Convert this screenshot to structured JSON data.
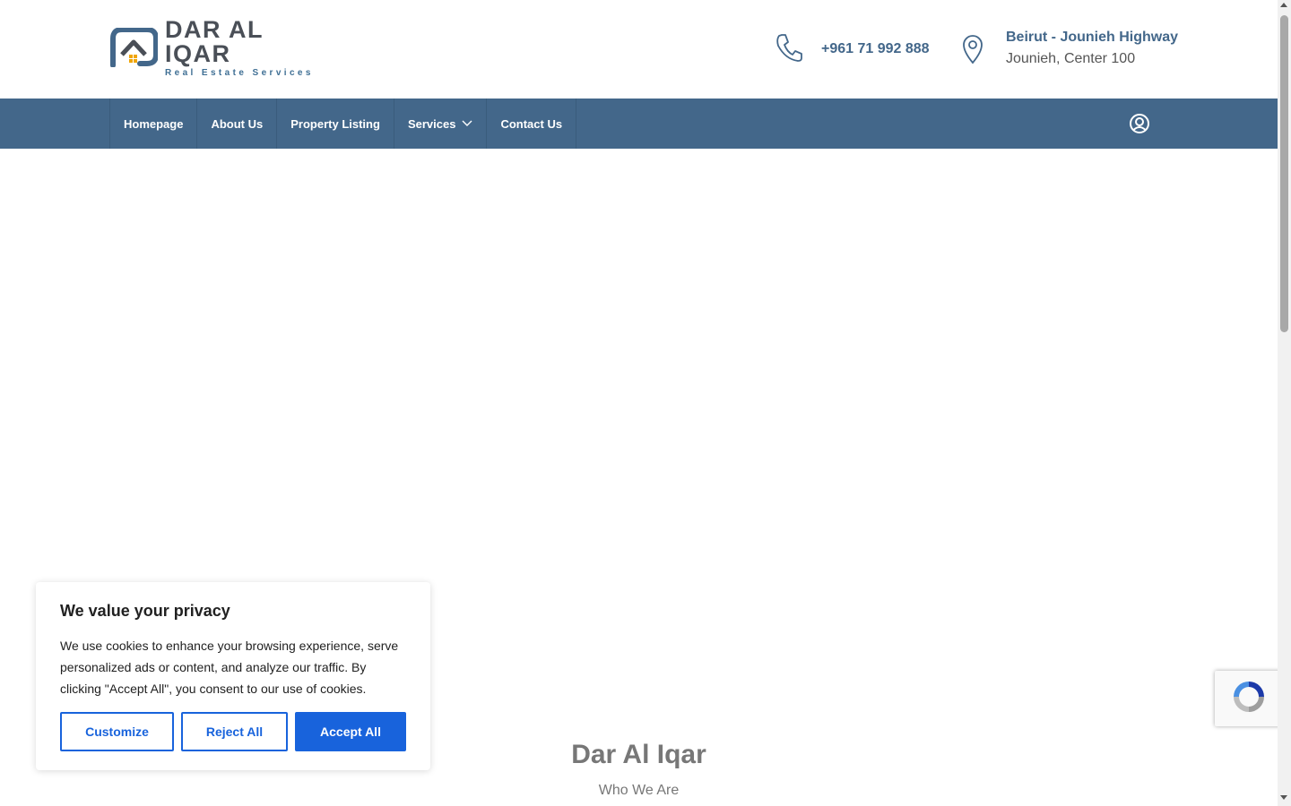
{
  "brand": {
    "name": "DAR AL IQAR",
    "tagline": "Real Estate Services",
    "colors": {
      "primary": "#43678a",
      "dark": "#4a4f57",
      "accent": "#f0a500"
    }
  },
  "header": {
    "phone": {
      "icon": "phone-icon",
      "text": "+961 71 992 888"
    },
    "address": {
      "icon": "map-pin-icon",
      "line1": "Beirut - Jounieh Highway",
      "line2": "Jounieh, Center 100"
    }
  },
  "nav": {
    "items": [
      {
        "label": "Homepage"
      },
      {
        "label": "About Us"
      },
      {
        "label": "Property Listing"
      },
      {
        "label": "Services",
        "icon": "chevron-down-icon"
      },
      {
        "label": "Contact Us"
      }
    ],
    "account_icon": "user-circle-icon"
  },
  "hero": {
    "title": "Dar Al Iqar",
    "subtitle": "Who We Are"
  },
  "cookie_banner": {
    "title": "We value your privacy",
    "text": "We use cookies to enhance your browsing experience, serve personalized ads or content, and analyze our traffic. By clicking \"Accept All\", you consent to our use of cookies.",
    "buttons": {
      "customize": "Customize",
      "reject": "Reject All",
      "accept": "Accept All"
    },
    "accent_color": "#1863dc"
  },
  "recaptcha": {
    "icon": "recaptcha-icon"
  }
}
